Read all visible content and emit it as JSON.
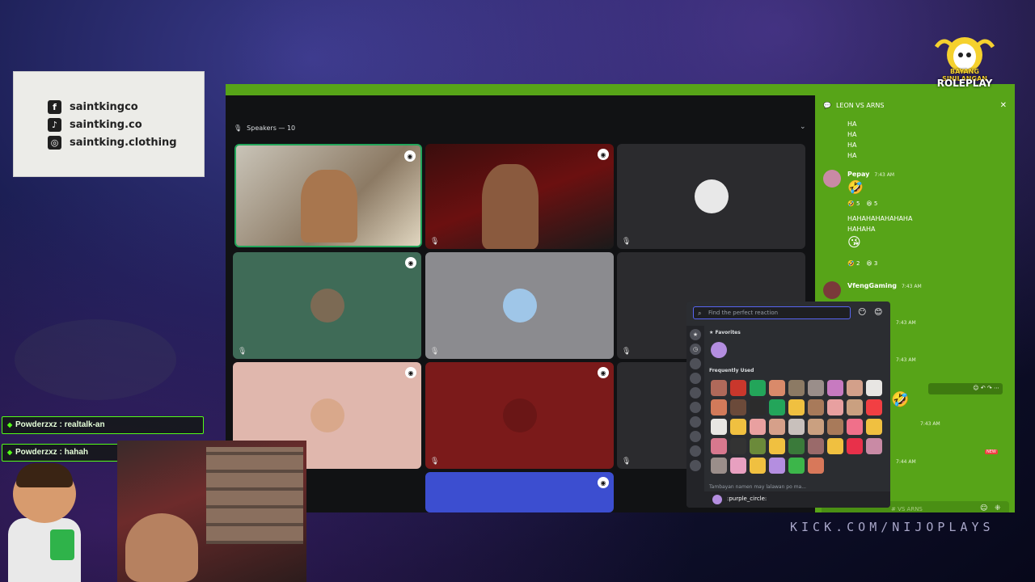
{
  "socials": [
    {
      "icon": "facebook-icon",
      "glyph": "f",
      "handle": "saintkingco"
    },
    {
      "icon": "tiktok-icon",
      "glyph": "♪",
      "handle": "saintking.co"
    },
    {
      "icon": "instagram-icon",
      "glyph": "◎",
      "handle": "saintking.clothing"
    }
  ],
  "voice": {
    "header": "Speakers — 10"
  },
  "chat": {
    "title": "LEON VS ARNS",
    "ha_lines": [
      "HA",
      "HA",
      "HA",
      "HA"
    ],
    "messages": [
      {
        "name": "Pepay",
        "time": "7:43 AM",
        "reactions": [
          "🤣 5",
          "😆 5"
        ],
        "text1": "HAHAHAHAHAHAHA",
        "text2": "HAHAHA",
        "reactions2": [
          "🤣 2",
          "😆 3"
        ]
      },
      {
        "name": "VfengGaming",
        "time": "7:43 AM"
      }
    ],
    "times": [
      "7:43 AM",
      "7:43 AM",
      "7:43 AM",
      "7:44 AM"
    ],
    "input_placeholder": "# VS ARNS",
    "new_badge": "NEW"
  },
  "picker": {
    "search_placeholder": "Find the perfect reaction",
    "favorites_label": "★ Favorites",
    "frequently_used_label": "Frequently Used",
    "footer_label": ":purple_circle:",
    "bottom_label": "Tambayan namen may lalawan po ma..."
  },
  "stream_chat": [
    {
      "user": "Powderzxz",
      "text": "realtalk-an"
    },
    {
      "user": "Powderzxz",
      "text": "hahah"
    }
  ],
  "stream_chat_lines": [
    "Powderzxz : realtalk-an",
    "Powderzxz : hahah"
  ],
  "logo": {
    "line1": "BAYANG SINILANGAN",
    "line2": "ROLEPLAY"
  },
  "kick_url": "KICK.COM/NIJOPLAYS",
  "colors": {
    "kick_green": "#53fc18",
    "discord_dark": "#111214",
    "chat_green": "#57a418"
  }
}
